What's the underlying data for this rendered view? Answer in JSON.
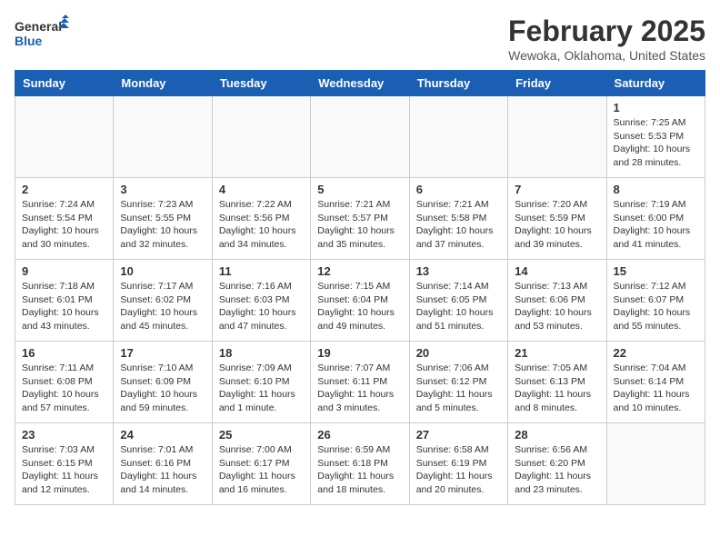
{
  "header": {
    "logo_line1": "General",
    "logo_line2": "Blue",
    "month_title": "February 2025",
    "location": "Wewoka, Oklahoma, United States"
  },
  "weekdays": [
    "Sunday",
    "Monday",
    "Tuesday",
    "Wednesday",
    "Thursday",
    "Friday",
    "Saturday"
  ],
  "weeks": [
    [
      {
        "day": "",
        "info": ""
      },
      {
        "day": "",
        "info": ""
      },
      {
        "day": "",
        "info": ""
      },
      {
        "day": "",
        "info": ""
      },
      {
        "day": "",
        "info": ""
      },
      {
        "day": "",
        "info": ""
      },
      {
        "day": "1",
        "info": "Sunrise: 7:25 AM\nSunset: 5:53 PM\nDaylight: 10 hours and 28 minutes."
      }
    ],
    [
      {
        "day": "2",
        "info": "Sunrise: 7:24 AM\nSunset: 5:54 PM\nDaylight: 10 hours and 30 minutes."
      },
      {
        "day": "3",
        "info": "Sunrise: 7:23 AM\nSunset: 5:55 PM\nDaylight: 10 hours and 32 minutes."
      },
      {
        "day": "4",
        "info": "Sunrise: 7:22 AM\nSunset: 5:56 PM\nDaylight: 10 hours and 34 minutes."
      },
      {
        "day": "5",
        "info": "Sunrise: 7:21 AM\nSunset: 5:57 PM\nDaylight: 10 hours and 35 minutes."
      },
      {
        "day": "6",
        "info": "Sunrise: 7:21 AM\nSunset: 5:58 PM\nDaylight: 10 hours and 37 minutes."
      },
      {
        "day": "7",
        "info": "Sunrise: 7:20 AM\nSunset: 5:59 PM\nDaylight: 10 hours and 39 minutes."
      },
      {
        "day": "8",
        "info": "Sunrise: 7:19 AM\nSunset: 6:00 PM\nDaylight: 10 hours and 41 minutes."
      }
    ],
    [
      {
        "day": "9",
        "info": "Sunrise: 7:18 AM\nSunset: 6:01 PM\nDaylight: 10 hours and 43 minutes."
      },
      {
        "day": "10",
        "info": "Sunrise: 7:17 AM\nSunset: 6:02 PM\nDaylight: 10 hours and 45 minutes."
      },
      {
        "day": "11",
        "info": "Sunrise: 7:16 AM\nSunset: 6:03 PM\nDaylight: 10 hours and 47 minutes."
      },
      {
        "day": "12",
        "info": "Sunrise: 7:15 AM\nSunset: 6:04 PM\nDaylight: 10 hours and 49 minutes."
      },
      {
        "day": "13",
        "info": "Sunrise: 7:14 AM\nSunset: 6:05 PM\nDaylight: 10 hours and 51 minutes."
      },
      {
        "day": "14",
        "info": "Sunrise: 7:13 AM\nSunset: 6:06 PM\nDaylight: 10 hours and 53 minutes."
      },
      {
        "day": "15",
        "info": "Sunrise: 7:12 AM\nSunset: 6:07 PM\nDaylight: 10 hours and 55 minutes."
      }
    ],
    [
      {
        "day": "16",
        "info": "Sunrise: 7:11 AM\nSunset: 6:08 PM\nDaylight: 10 hours and 57 minutes."
      },
      {
        "day": "17",
        "info": "Sunrise: 7:10 AM\nSunset: 6:09 PM\nDaylight: 10 hours and 59 minutes."
      },
      {
        "day": "18",
        "info": "Sunrise: 7:09 AM\nSunset: 6:10 PM\nDaylight: 11 hours and 1 minute."
      },
      {
        "day": "19",
        "info": "Sunrise: 7:07 AM\nSunset: 6:11 PM\nDaylight: 11 hours and 3 minutes."
      },
      {
        "day": "20",
        "info": "Sunrise: 7:06 AM\nSunset: 6:12 PM\nDaylight: 11 hours and 5 minutes."
      },
      {
        "day": "21",
        "info": "Sunrise: 7:05 AM\nSunset: 6:13 PM\nDaylight: 11 hours and 8 minutes."
      },
      {
        "day": "22",
        "info": "Sunrise: 7:04 AM\nSunset: 6:14 PM\nDaylight: 11 hours and 10 minutes."
      }
    ],
    [
      {
        "day": "23",
        "info": "Sunrise: 7:03 AM\nSunset: 6:15 PM\nDaylight: 11 hours and 12 minutes."
      },
      {
        "day": "24",
        "info": "Sunrise: 7:01 AM\nSunset: 6:16 PM\nDaylight: 11 hours and 14 minutes."
      },
      {
        "day": "25",
        "info": "Sunrise: 7:00 AM\nSunset: 6:17 PM\nDaylight: 11 hours and 16 minutes."
      },
      {
        "day": "26",
        "info": "Sunrise: 6:59 AM\nSunset: 6:18 PM\nDaylight: 11 hours and 18 minutes."
      },
      {
        "day": "27",
        "info": "Sunrise: 6:58 AM\nSunset: 6:19 PM\nDaylight: 11 hours and 20 minutes."
      },
      {
        "day": "28",
        "info": "Sunrise: 6:56 AM\nSunset: 6:20 PM\nDaylight: 11 hours and 23 minutes."
      },
      {
        "day": "",
        "info": ""
      }
    ]
  ]
}
